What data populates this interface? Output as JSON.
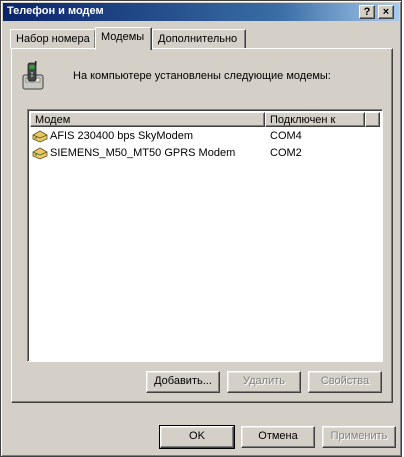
{
  "window": {
    "title": "Телефон и модем",
    "help_glyph": "?",
    "close_glyph": "×"
  },
  "tabs": [
    {
      "label": "Набор номера",
      "active": false
    },
    {
      "label": "Модемы",
      "active": true
    },
    {
      "label": "Дополнительно",
      "active": false
    }
  ],
  "panel": {
    "intro": "На компьютере установлены следующие модемы:",
    "columns": {
      "modem": "Модем",
      "connected_to": "Подключен к"
    },
    "modems": [
      {
        "name": "AFIS 230400 bps SkyModem",
        "port": "COM4"
      },
      {
        "name": "SIEMENS_M50_MT50 GPRS Modem",
        "port": "COM2"
      }
    ],
    "buttons": {
      "add": "Добавить...",
      "remove": "Удалить",
      "properties": "Свойства"
    }
  },
  "footer": {
    "ok": "OK",
    "cancel": "Отмена",
    "apply": "Применить"
  },
  "icons": {
    "modem": "modem-phone-icon",
    "row": "modem-device-icon"
  },
  "colors": {
    "title_start": "#0a246a",
    "title_end": "#a6caf0",
    "face": "#d4d0c8"
  }
}
